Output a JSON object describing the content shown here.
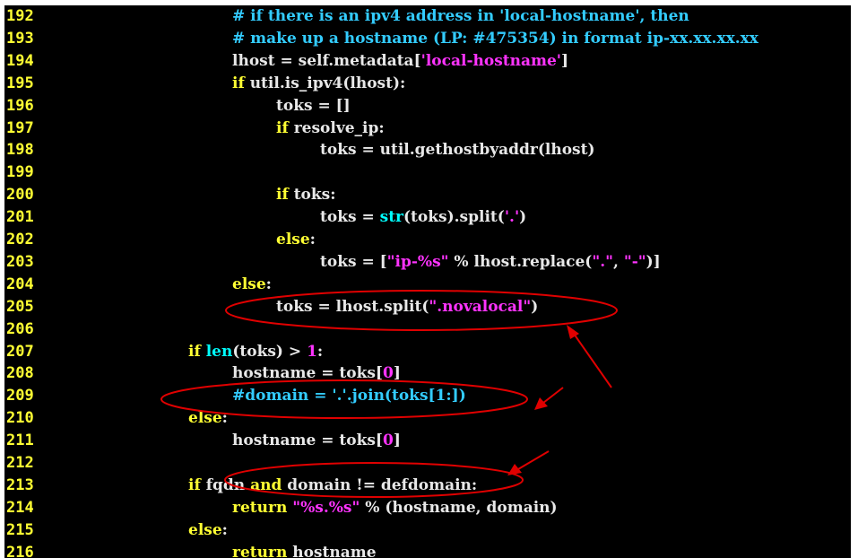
{
  "colors": {
    "background": "#000000",
    "line_number": "#ffff33",
    "default": "#e8e8e8",
    "keyword": "#ffff33",
    "comment": "#33ccff",
    "string": "#ff33ff",
    "number": "#ff33ff",
    "builtin": "#00ffff",
    "annotation": "#e00000"
  },
  "lines": [
    {
      "n": "192",
      "indent": 4,
      "segments": [
        {
          "t": "# if there is an ipv4 address in 'local-hostname', then",
          "c": "comment"
        }
      ]
    },
    {
      "n": "193",
      "indent": 4,
      "segments": [
        {
          "t": "# make up a hostname (LP: #475354) in format ip-xx.xx.xx.xx",
          "c": "comment"
        }
      ]
    },
    {
      "n": "194",
      "indent": 4,
      "segments": [
        {
          "t": "lhost = self.metadata[",
          "c": "default"
        },
        {
          "t": "'local-hostname'",
          "c": "string"
        },
        {
          "t": "]",
          "c": "default"
        }
      ]
    },
    {
      "n": "195",
      "indent": 4,
      "segments": [
        {
          "t": "if",
          "c": "keyword"
        },
        {
          "t": " util.is_ipv4(lhost):",
          "c": "default"
        }
      ]
    },
    {
      "n": "196",
      "indent": 5,
      "segments": [
        {
          "t": "toks = []",
          "c": "default"
        }
      ]
    },
    {
      "n": "197",
      "indent": 5,
      "segments": [
        {
          "t": "if",
          "c": "keyword"
        },
        {
          "t": " resolve_ip:",
          "c": "default"
        }
      ]
    },
    {
      "n": "198",
      "indent": 6,
      "segments": [
        {
          "t": "toks = util.gethostbyaddr(lhost)",
          "c": "default"
        }
      ]
    },
    {
      "n": "199",
      "indent": 0,
      "segments": []
    },
    {
      "n": "200",
      "indent": 5,
      "segments": [
        {
          "t": "if",
          "c": "keyword"
        },
        {
          "t": " toks:",
          "c": "default"
        }
      ]
    },
    {
      "n": "201",
      "indent": 6,
      "segments": [
        {
          "t": "toks = ",
          "c": "default"
        },
        {
          "t": "str",
          "c": "builtin"
        },
        {
          "t": "(toks).split(",
          "c": "default"
        },
        {
          "t": "'.'",
          "c": "string"
        },
        {
          "t": ")",
          "c": "default"
        }
      ]
    },
    {
      "n": "202",
      "indent": 5,
      "segments": [
        {
          "t": "else",
          "c": "keyword"
        },
        {
          "t": ":",
          "c": "default"
        }
      ]
    },
    {
      "n": "203",
      "indent": 6,
      "segments": [
        {
          "t": "toks = [",
          "c": "default"
        },
        {
          "t": "\"ip-%s\"",
          "c": "string"
        },
        {
          "t": " % lhost.replace(",
          "c": "default"
        },
        {
          "t": "\".\"",
          "c": "string"
        },
        {
          "t": ", ",
          "c": "default"
        },
        {
          "t": "\"-\"",
          "c": "string"
        },
        {
          "t": ")]",
          "c": "default"
        }
      ]
    },
    {
      "n": "204",
      "indent": 4,
      "segments": [
        {
          "t": "else",
          "c": "keyword"
        },
        {
          "t": ":",
          "c": "default"
        }
      ]
    },
    {
      "n": "205",
      "indent": 5,
      "segments": [
        {
          "t": "toks = lhost.split(",
          "c": "default"
        },
        {
          "t": "\".novalocal\"",
          "c": "string"
        },
        {
          "t": ")",
          "c": "default"
        }
      ]
    },
    {
      "n": "206",
      "indent": 0,
      "segments": []
    },
    {
      "n": "207",
      "indent": 3,
      "segments": [
        {
          "t": "if",
          "c": "keyword"
        },
        {
          "t": " ",
          "c": "default"
        },
        {
          "t": "len",
          "c": "builtin"
        },
        {
          "t": "(toks) > ",
          "c": "default"
        },
        {
          "t": "1",
          "c": "number"
        },
        {
          "t": ":",
          "c": "default"
        }
      ]
    },
    {
      "n": "208",
      "indent": 4,
      "segments": [
        {
          "t": "hostname = toks[",
          "c": "default"
        },
        {
          "t": "0",
          "c": "number"
        },
        {
          "t": "]",
          "c": "default"
        }
      ]
    },
    {
      "n": "209",
      "indent": 4,
      "segments": [
        {
          "t": "#domain = '.'.join(toks[1:])",
          "c": "comment"
        }
      ]
    },
    {
      "n": "210",
      "indent": 3,
      "segments": [
        {
          "t": "else",
          "c": "keyword"
        },
        {
          "t": ":",
          "c": "default"
        }
      ]
    },
    {
      "n": "211",
      "indent": 4,
      "segments": [
        {
          "t": "hostname = toks[",
          "c": "default"
        },
        {
          "t": "0",
          "c": "number"
        },
        {
          "t": "]",
          "c": "default"
        }
      ]
    },
    {
      "n": "212",
      "indent": 0,
      "segments": []
    },
    {
      "n": "213",
      "indent": 3,
      "segments": [
        {
          "t": "if",
          "c": "keyword"
        },
        {
          "t": " fqdn ",
          "c": "default"
        },
        {
          "t": "and",
          "c": "keyword"
        },
        {
          "t": " domain != defdomain:",
          "c": "default"
        }
      ]
    },
    {
      "n": "214",
      "indent": 4,
      "segments": [
        {
          "t": "return",
          "c": "keyword"
        },
        {
          "t": " ",
          "c": "default"
        },
        {
          "t": "\"%s.%s\"",
          "c": "string"
        },
        {
          "t": " % (hostname, domain)",
          "c": "default"
        }
      ]
    },
    {
      "n": "215",
      "indent": 3,
      "segments": [
        {
          "t": "else",
          "c": "keyword"
        },
        {
          "t": ":",
          "c": "default"
        }
      ]
    },
    {
      "n": "216",
      "indent": 4,
      "segments": [
        {
          "t": "return",
          "c": "keyword"
        },
        {
          "t": " hostname",
          "c": "default"
        }
      ]
    }
  ]
}
